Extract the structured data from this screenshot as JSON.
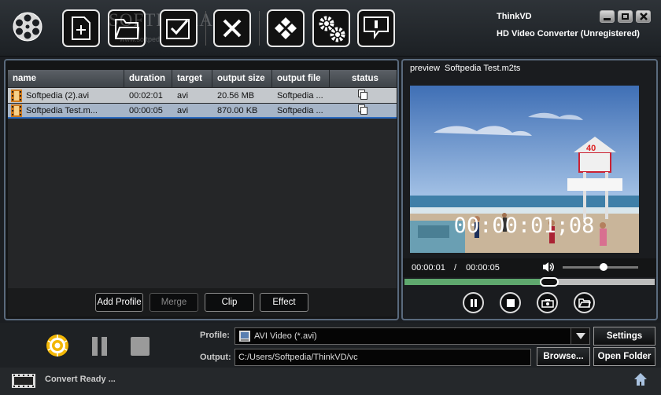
{
  "app": {
    "title": "ThinkVD",
    "subtitle": "HD Video Converter (Unregistered)"
  },
  "toolbar": [
    "reel-icon",
    "add-file-icon",
    "folder-icon",
    "checkbox-icon",
    "remove-icon",
    "diamond-icon",
    "settings-gears-icon",
    "help-icon"
  ],
  "watermark": {
    "brand": "SOFTPEDIA",
    "site": "www.softpedia.com"
  },
  "list": {
    "columns": [
      "name",
      "duration",
      "target",
      "output size",
      "output file",
      "status"
    ],
    "rows": [
      {
        "name": "Softpedia (2).avi",
        "duration": "00:02:01",
        "target": "avi",
        "size": "20.56 MB",
        "file": "Softpedia ..."
      },
      {
        "name": "Softpedia Test.m...",
        "duration": "00:00:05",
        "target": "avi",
        "size": "870.00 KB",
        "file": "Softpedia ..."
      }
    ],
    "buttons": {
      "add_profile": "Add Profile",
      "merge": "Merge",
      "clip": "Clip",
      "effect": "Effect"
    }
  },
  "preview": {
    "label": "preview",
    "file": "Softpedia Test.m2ts",
    "timecode": "00:00:01;08",
    "current": "00:00:01",
    "sep": "/",
    "total": "00:00:05",
    "lifeguard_number": "40",
    "progress": 0.58,
    "volume": 0.54
  },
  "bottom": {
    "profile_label": "Profile:",
    "profile_value": "AVI Video (*.avi)",
    "output_label": "Output:",
    "output_value": "C:/Users/Softpedia/ThinkVD/vc",
    "settings": "Settings",
    "browse": "Browse...",
    "open_folder": "Open Folder",
    "status": "Convert Ready ..."
  },
  "colors": {
    "accent_border": "#5a6a7d",
    "row_selected": "#a6b5c8",
    "row_normal": "#c4c8cc",
    "timeline": "#5fa86e"
  }
}
